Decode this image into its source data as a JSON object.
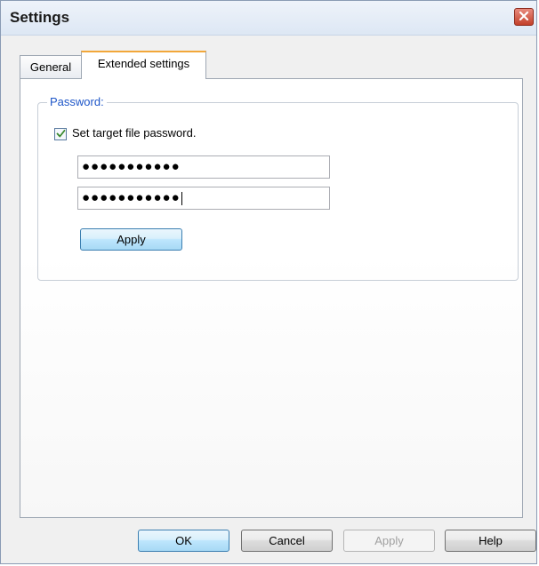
{
  "window": {
    "title": "Settings",
    "close_icon": "close-icon"
  },
  "tabs": [
    {
      "label": "General",
      "active": false
    },
    {
      "label": "Extended settings",
      "active": true
    }
  ],
  "password_group": {
    "label": "Password:",
    "checkbox": {
      "label": "Set target file password.",
      "checked": true
    },
    "field1": {
      "value": "●●●●●●●●●●●"
    },
    "field2": {
      "value": "●●●●●●●●●●●"
    },
    "apply_label": "Apply"
  },
  "footer": {
    "ok_label": "OK",
    "cancel_label": "Cancel",
    "apply_label": "Apply",
    "help_label": "Help"
  },
  "colors": {
    "accent": "#1e56c8",
    "tab_highlight": "#f2a73a",
    "close": "#c3402a"
  }
}
